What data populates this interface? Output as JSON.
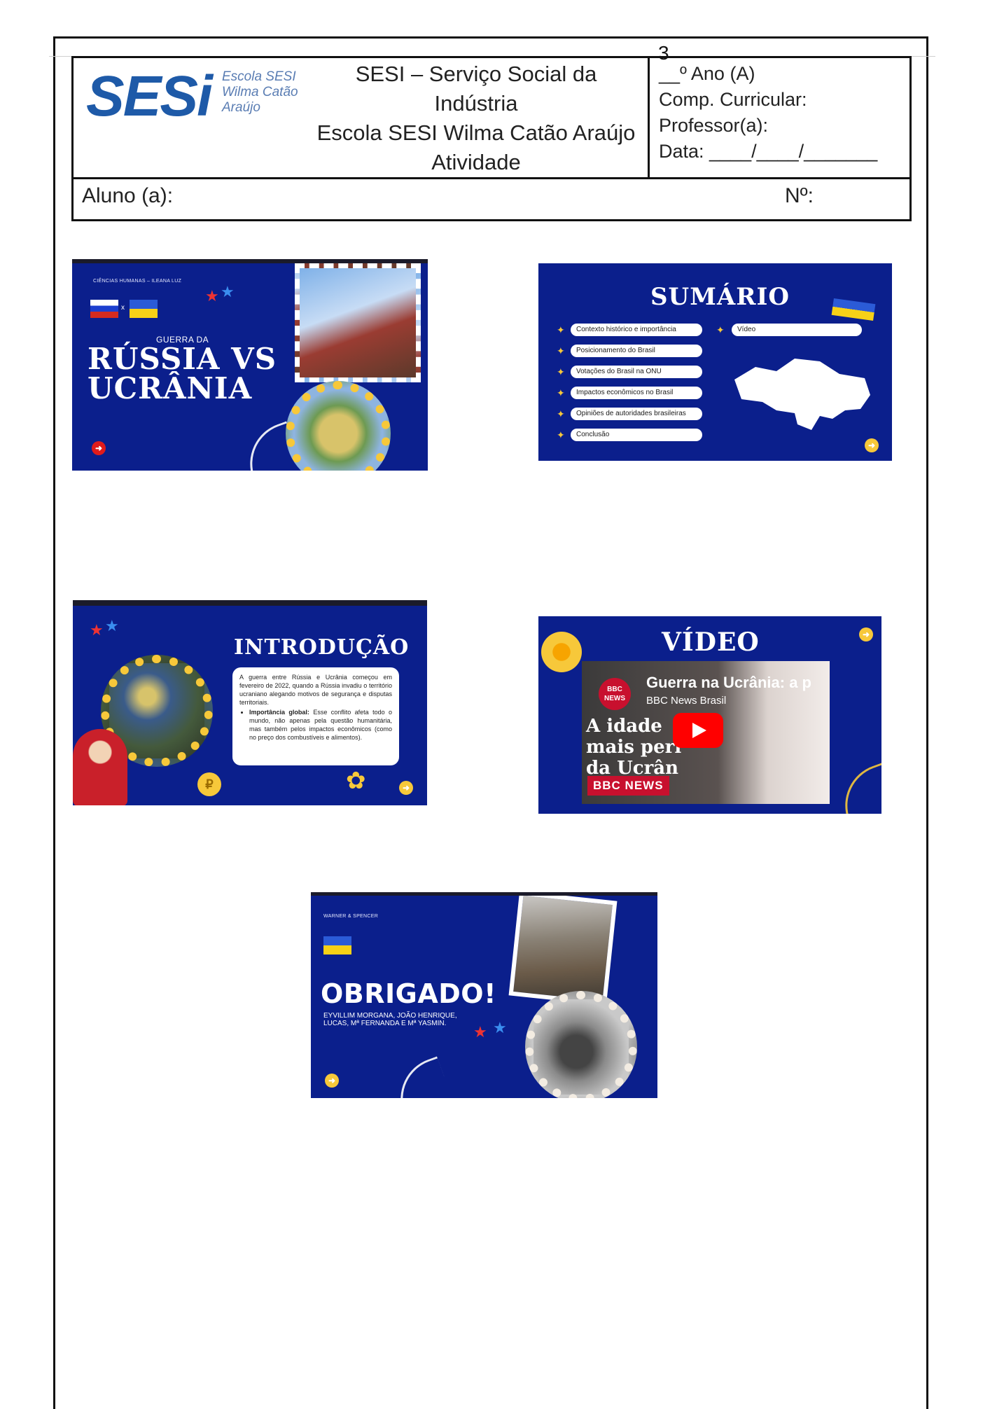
{
  "page": {
    "number": "3"
  },
  "header": {
    "logo_text": "SESi",
    "logo_school_lines": [
      "Escola SESI",
      "Wilma Catão",
      "Araújo"
    ],
    "title_lines": [
      "SESI – Serviço Social da",
      "Indústria",
      "Escola SESI Wilma Catão Araújo",
      "Atividade"
    ],
    "info_lines": [
      "__º Ano (A)",
      "Comp. Curricular:",
      "Professor(a):",
      "Data: ____/____/_______"
    ],
    "student_label": "Aluno (a):",
    "number_label": "Nº:"
  },
  "slides": {
    "cover": {
      "course": "CIÊNCIAS HUMANAS – ILEANA LUZ",
      "flag_separator": "x",
      "subtitle": "GUERRA DA",
      "title_line1": "RÚSSIA VS",
      "title_line2": "UCRÂNIA",
      "arrow": "➜"
    },
    "summary": {
      "title": "SUMÁRIO",
      "items": [
        "Contexto histórico e importância",
        "Posicionamento do Brasil",
        "Votações do Brasil na ONU",
        "Impactos econômicos no Brasil",
        "Opiniões de autoridades brasileiras",
        "Conclusão",
        "Vídeo"
      ],
      "arrow": "➜"
    },
    "intro": {
      "title": "INTRODUÇÃO",
      "paragraph": "A guerra entre Rússia e Ucrânia começou em fevereiro de 2022, quando a Rússia invadiu o território ucraniano alegando motivos de segurança e disputas territoriais.",
      "bullet_label": "Importância global:",
      "bullet_text": "Esse conflito afeta todo o mundo, não apenas pela questão humanitária, mas também pelos impactos econômicos (como no preço dos combustíveis e alimentos).",
      "coin": "₽",
      "arrow": "➜"
    },
    "video": {
      "title": "VÍDEO",
      "video_title": "Guerra na Ucrânia: a p",
      "channel": "BBC News Brasil",
      "badge": "BBC NEWS",
      "overlay_lines": [
        "A  idade",
        "mais peri",
        "da Ucrân"
      ],
      "brand": "BBC NEWS",
      "arrow": "➜"
    },
    "thanks": {
      "course": "WARNER & SPENCER",
      "title": "OBRIGADO!",
      "names_line1": "EYVILLIM MORGANA, JOÃO HENRIQUE,",
      "names_line2": "LUCAS, Mª FERNANDA E Mª YASMIN.",
      "arrow": "➜"
    }
  },
  "colors": {
    "slide_bg": "#0b1f8c",
    "accent_yellow": "#f7c83a",
    "sesi_blue": "#1e5aa8"
  }
}
